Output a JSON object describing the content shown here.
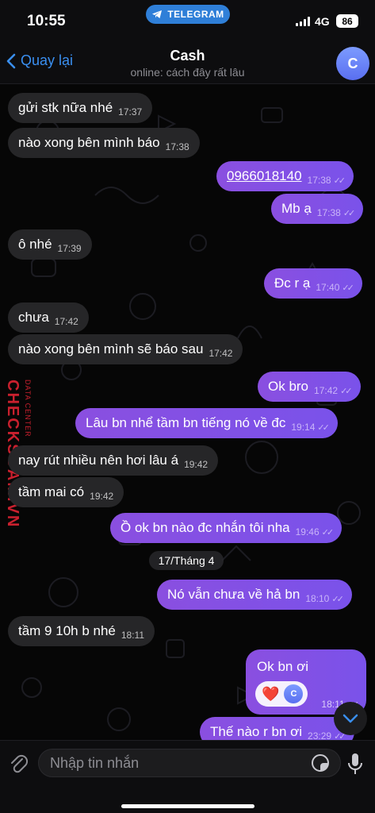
{
  "status_bar": {
    "time": "10:55",
    "app_pill": "TELEGRAM",
    "network": "4G",
    "battery": "86"
  },
  "header": {
    "back_label": "Quay lại",
    "title": "Cash",
    "subtitle": "online: cách đây rất lâu",
    "avatar_letter": "C"
  },
  "messages": [
    {
      "dir": "in",
      "text": "gửi stk nữa nhé",
      "time": "17:37"
    },
    {
      "dir": "in",
      "text": "nào xong bên mình báo",
      "time": "17:38"
    },
    {
      "dir": "out",
      "text": "0966018140",
      "time": "17:38"
    },
    {
      "dir": "out",
      "text": "Mb ạ",
      "time": "17:38"
    },
    {
      "dir": "in",
      "text": "ô nhé",
      "time": "17:39"
    },
    {
      "dir": "out",
      "text": "Đc r ạ",
      "time": "17:40"
    },
    {
      "dir": "in",
      "text": "chưa",
      "time": "17:42"
    },
    {
      "dir": "in",
      "text": "nào xong bên mình sẽ báo sau",
      "time": "17:42"
    },
    {
      "dir": "out",
      "text": "Ok bro",
      "time": "17:42"
    },
    {
      "dir": "out",
      "text": "Lâu bn nhể tầm bn tiếng nó về đc",
      "time": "19:14"
    },
    {
      "dir": "in",
      "text": "nay rút nhiều nên hơi lâu á",
      "time": "19:42"
    },
    {
      "dir": "in",
      "text": "tầm mai có",
      "time": "19:42"
    },
    {
      "dir": "out",
      "text": "Ồ ok bn nào đc nhắn tôi nha",
      "time": "19:46"
    },
    {
      "dir": "out",
      "text": "Nó vẫn chưa về hả bn",
      "time": "18:10"
    },
    {
      "dir": "in",
      "text": "tầm 9 10h b nhé",
      "time": "18:11"
    },
    {
      "dir": "out",
      "text": "Ok bn ơi",
      "time": "18:11"
    },
    {
      "dir": "out",
      "text": "Thế nào r bn ơi",
      "time": "23:29"
    }
  ],
  "date_separator": "17/Tháng 4",
  "reaction": {
    "emoji": "❤️",
    "avatar_letter": "C"
  },
  "watermark": {
    "brand": "CHECKSCAM.VN",
    "tagline": "DATA CENTER"
  },
  "composer": {
    "placeholder": "Nhập tin nhắn"
  },
  "colors": {
    "accent": "#3a8ff0",
    "outgoing": "#8a4fe0",
    "incoming": "#262628",
    "watermark": "#c9202e"
  }
}
